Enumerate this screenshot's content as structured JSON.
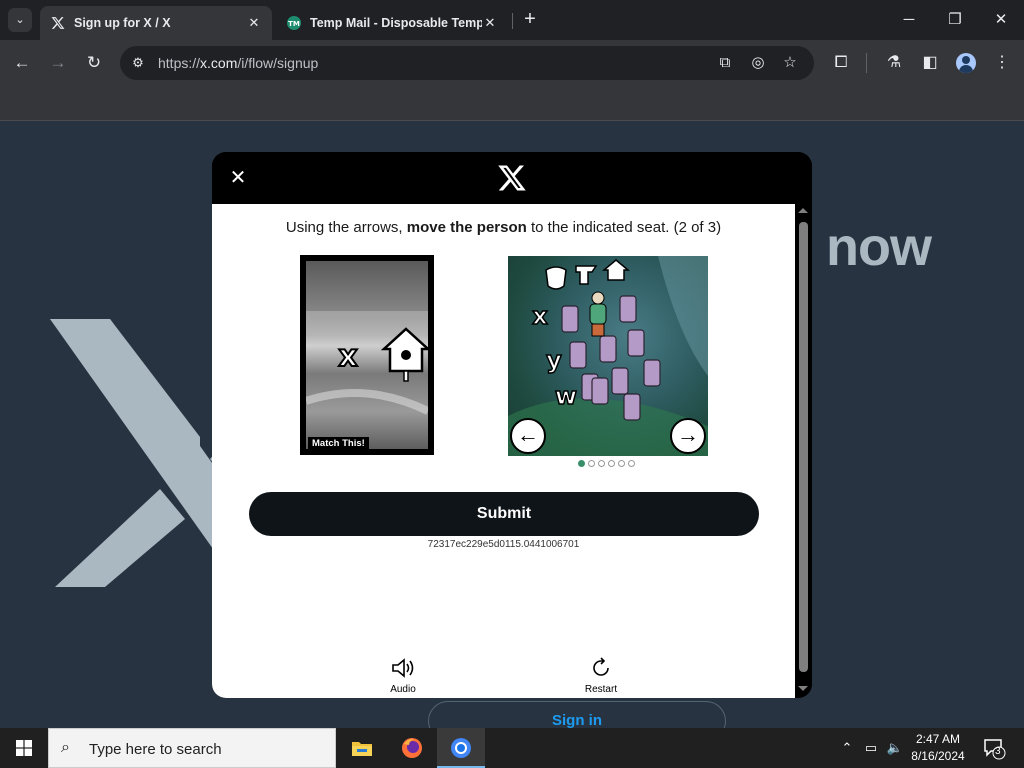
{
  "browser": {
    "tabs": [
      {
        "title": "Sign up for X / X",
        "favicon": "x-logo-icon",
        "active": true
      },
      {
        "title": "Temp Mail - Disposable Tempo",
        "favicon": "tempmail-icon",
        "active": false
      }
    ],
    "tab_close": "✕",
    "new_tab": "+",
    "url_prefix": "https://",
    "url_host": "x.com",
    "url_path": "/i/flow/signup"
  },
  "page": {
    "background_word": "now",
    "signin_label": "Sign in"
  },
  "modal": {
    "close_glyph": "✕",
    "instruction_pre": "Using the arrows, ",
    "instruction_bold": "move the person",
    "instruction_post": " to the indicated seat. (2 of 3)",
    "reference_label": "Match This!",
    "reference_letter": "x",
    "puzzle_letters": [
      "x",
      "y",
      "w"
    ],
    "left_arrow": "←",
    "right_arrow": "→",
    "dots_total": 6,
    "dots_active_index": 0,
    "submit_label": "Submit",
    "session_id": "72317ec229e5d0115.0441006701",
    "audio_label": "Audio",
    "restart_label": "Restart"
  },
  "taskbar": {
    "search_placeholder": "Type here to search",
    "time": "2:47 AM",
    "date": "8/16/2024",
    "notification_count": "3"
  },
  "colors": {
    "page_bg": "#273340",
    "x_logo_bg": "#aab8c2",
    "submit_bg": "#0f1419",
    "dot_active": "#3a8f6b"
  }
}
